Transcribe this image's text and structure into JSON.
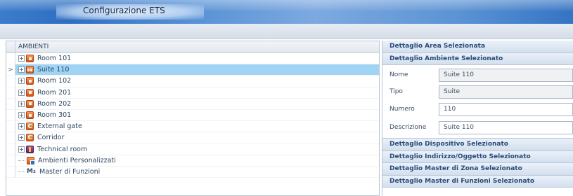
{
  "window": {
    "title": "Configurazione ETS"
  },
  "tree": {
    "header": "AMBIENTI",
    "items": [
      {
        "label": "Room 101",
        "icon": "room-icon",
        "expandable": true,
        "expander": "+"
      },
      {
        "label": "Suite 110",
        "icon": "suite-icon",
        "expandable": true,
        "expander": "+",
        "selected": true,
        "row_pointer": ">"
      },
      {
        "label": "Room 102",
        "icon": "room-icon",
        "expandable": true,
        "expander": "+"
      },
      {
        "label": "Room 201",
        "icon": "room-icon",
        "expandable": true,
        "expander": "+"
      },
      {
        "label": "Room 202",
        "icon": "room-icon",
        "expandable": true,
        "expander": "+"
      },
      {
        "label": "Room 301",
        "icon": "room-icon",
        "expandable": true,
        "expander": "+"
      },
      {
        "label": "External gate",
        "icon": "common-area-icon",
        "icon_letter": "C",
        "expandable": true,
        "expander": "+"
      },
      {
        "label": "Corridor",
        "icon": "common-area-icon",
        "icon_letter": "C",
        "expandable": true,
        "expander": "+"
      },
      {
        "label": "Technical room",
        "icon": "technical-room-icon",
        "expandable": true,
        "expander": "+"
      },
      {
        "label": "Ambienti Personalizzati",
        "icon": "custom-ambient-icon",
        "expandable": false
      },
      {
        "label": "Master di Funzioni",
        "icon": "master-functions-icon",
        "icon_glyph": "M₂",
        "expandable": false
      }
    ]
  },
  "details": {
    "area_section": "Dettaglio Area Selezionata",
    "ambient_section": "Dettaglio Ambiente Selezionato",
    "fields": {
      "nome": {
        "label": "Nome",
        "value": "Suite 110"
      },
      "tipo": {
        "label": "Tipo",
        "value": "Suite"
      },
      "numero": {
        "label": "Numero",
        "value": "110"
      },
      "descrizione": {
        "label": "Descrizione",
        "value": "Suite 110"
      }
    },
    "device_section": "Dettaglio Dispositivo Selezionato",
    "address_section": "Dettaglio Indirizzo/Oggetto Selezionato",
    "zone_master_section": "Dettaglio Master di Zona Selezionato",
    "function_master_section": "Dettaglio Master di Funzioni Selezionato"
  }
}
